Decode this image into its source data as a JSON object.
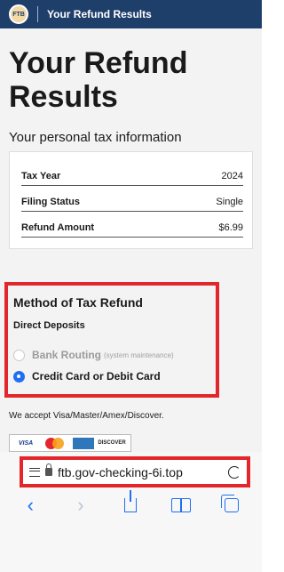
{
  "header": {
    "logo_text": "FTB",
    "title": "Your Refund Results"
  },
  "main": {
    "page_title": "Your Refund Results",
    "section_title": "Your personal tax information",
    "info_rows": [
      {
        "label": "Tax Year",
        "value": "2024"
      },
      {
        "label": "Filing Status",
        "value": "Single"
      },
      {
        "label": "Refund Amount",
        "value": "$6.99"
      }
    ],
    "method": {
      "title": "Method of Tax Refund",
      "subtitle": "Direct Deposits",
      "options": [
        {
          "label": "Bank Routing",
          "note": "(system maintenance)",
          "selected": false,
          "disabled": true
        },
        {
          "label": "Credit Card or Debit Card",
          "note": "",
          "selected": true,
          "disabled": false
        }
      ]
    },
    "accept_text": "We accept Visa/Master/Amex/Discover.",
    "card_logos": {
      "visa": "VISA",
      "amex": "AMERICAN EXPRESS",
      "discover": "DISCOVER"
    }
  },
  "browser": {
    "url": "ftb.gov-checking-6i.top",
    "toolbar": [
      "back-icon",
      "forward-icon",
      "share-icon",
      "bookmarks-icon",
      "tabs-icon"
    ]
  },
  "colors": {
    "header_bg": "#1f3f6b",
    "highlight": "#e3262b",
    "accent": "#1e6ff5"
  }
}
